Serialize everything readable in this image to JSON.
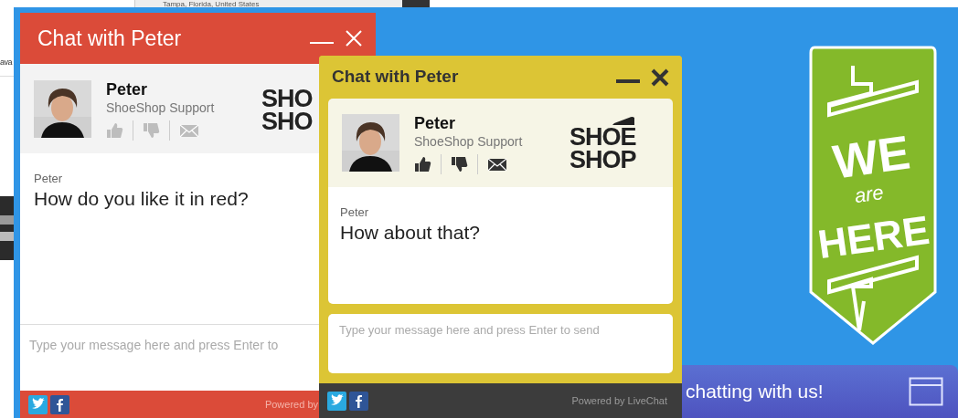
{
  "background": {
    "location_text": "Tampa, Florida, United States",
    "side_text": "ava"
  },
  "chat_windows": [
    {
      "kind": "flat",
      "color": "#db4b39",
      "title": "Chat with Peter",
      "agent": {
        "name": "Peter",
        "role": "ShoeShop Support"
      },
      "logo": [
        "SHO",
        "SHO"
      ],
      "message": {
        "author": "Peter",
        "text": "How do you like it in red?"
      },
      "input": {
        "placeholder": "Type your message here and press Enter to"
      },
      "footer": "Powered by"
    },
    {
      "kind": "framed",
      "color": "#dcc535",
      "title": "Chat with Peter",
      "agent": {
        "name": "Peter",
        "role": "ShoeShop Support"
      },
      "logo": [
        "SHOE",
        "SHOP"
      ],
      "message": {
        "author": "Peter",
        "text": "How about that?"
      },
      "input": {
        "placeholder": "Type your message here and press Enter to send"
      },
      "footer": "Powered by LiveChat"
    }
  ],
  "badge": {
    "lines": [
      "WE",
      "are",
      "HERE"
    ]
  },
  "chat_bar": {
    "text": "chatting with us!"
  }
}
